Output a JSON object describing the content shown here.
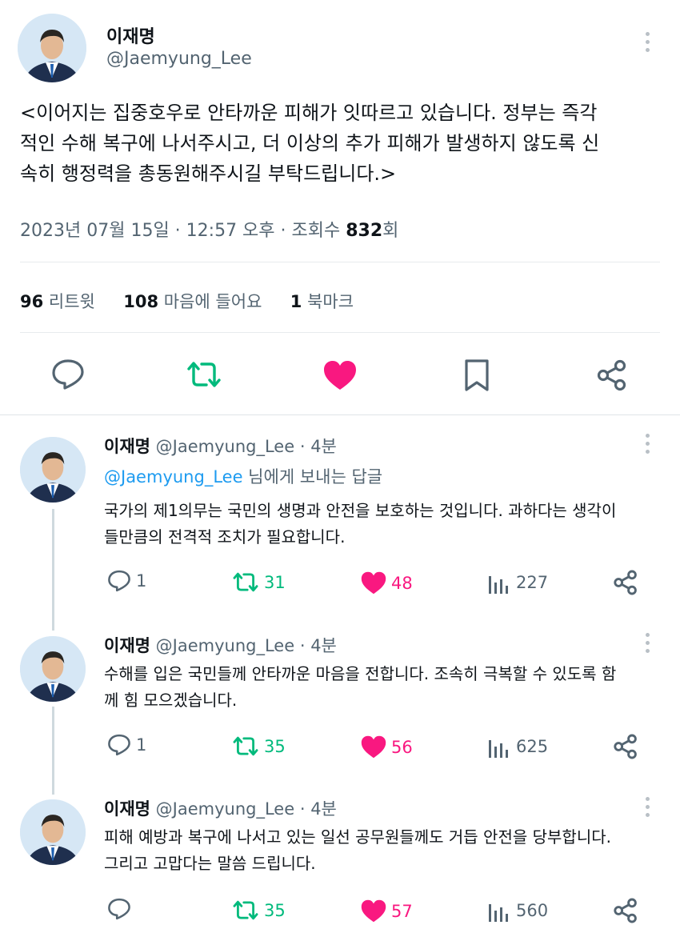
{
  "main_tweet": {
    "display_name": "이재명",
    "handle": "@Jaemyung_Lee",
    "text_lines": [
      "<이어지는 집중호우로 안타까운 피해가 잇따르고 있습니다. 정부는 즉각",
      "적인 수해 복구에 나서주시고, 더 이상의 추가 피해가 발생하지 않도록 신",
      "속히 행정력을 총동원해주시길 부탁드립니다.>"
    ],
    "date": "2023년 07월 15일 · 12:57 오후 · 조회수 ",
    "views": "832",
    "views_suffix": "회",
    "stats": {
      "retweets_count": "96",
      "retweets_label": "리트윗",
      "likes_count": "108",
      "likes_label": "마음에 들어요",
      "bookmarks_count": "1",
      "bookmarks_label": "북마크"
    }
  },
  "replies": [
    {
      "display_name": "이재명",
      "handle": "@Jaemyung_Lee",
      "time": "· 4분",
      "reply_to_handle": "@Jaemyung_Lee",
      "reply_to_suffix": " 님에게 보내는 답글",
      "text_lines": [
        "국가의 제1의무는 국민의 생명과 안전을 보호하는 것입니다. 과하다는 생각이",
        "들만큼의 전격적 조치가 필요합니다."
      ],
      "replies": "1",
      "retweets": "31",
      "likes": "48",
      "views": "227"
    },
    {
      "display_name": "이재명",
      "handle": "@Jaemyung_Lee",
      "time": "· 4분",
      "text_lines": [
        "수해를 입은 국민들께 안타까운 마음을 전합니다. 조속히 극복할 수 있도록 함",
        "께 힘 모으겠습니다."
      ],
      "replies": "1",
      "retweets": "35",
      "likes": "56",
      "views": "625"
    },
    {
      "display_name": "이재명",
      "handle": "@Jaemyung_Lee",
      "time": "· 4분",
      "text_lines": [
        "피해 예방과 복구에 나서고 있는 일선 공무원들께도 거듭 안전을 당부합니다.",
        "그리고 고맙다는 말씀 드립니다."
      ],
      "replies": "",
      "retweets": "35",
      "likes": "57",
      "views": "560"
    }
  ],
  "colors": {
    "retweet_green": "#00ba7c",
    "like_pink": "#f91880",
    "muted_gray": "#536471"
  },
  "icons": [
    "more-icon",
    "reply-icon",
    "retweet-icon",
    "like-icon",
    "bookmark-icon",
    "share-icon",
    "views-icon"
  ]
}
